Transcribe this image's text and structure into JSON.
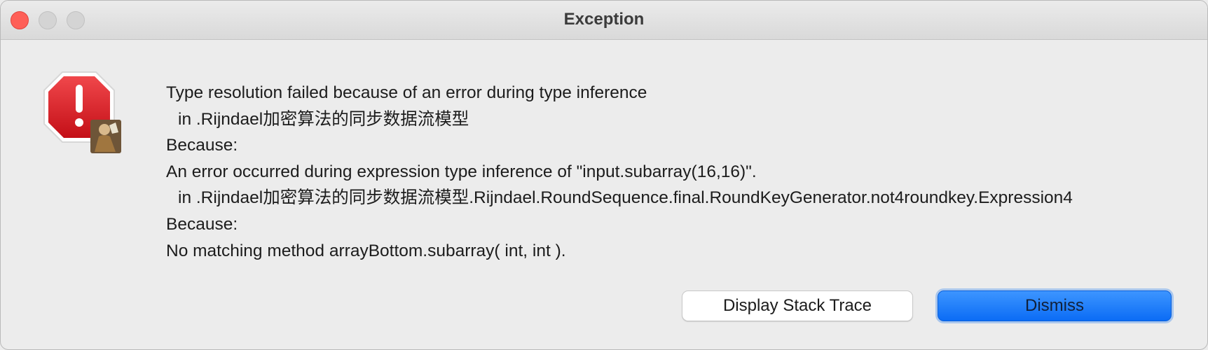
{
  "window": {
    "title": "Exception"
  },
  "dialog": {
    "icon": "error-stop-icon",
    "message_lines": [
      "Type resolution failed because of an error during type inference",
      "in .Rijndael加密算法的同步数据流模型",
      "Because:",
      "An error occurred during expression type inference of \"input.subarray(16,16)\".",
      "in .Rijndael加密算法的同步数据流模型.Rijndael.RoundSequence.final.RoundKeyGenerator.not4roundkey.Expression4",
      "Because:",
      "No matching method arrayBottom.subarray( int, int )."
    ]
  },
  "buttons": {
    "stack_trace_label": "Display Stack Trace",
    "dismiss_label": "Dismiss"
  },
  "colors": {
    "close": "#fe5f57",
    "accent": "#0b6cf5",
    "error_red": "#d8101a"
  }
}
